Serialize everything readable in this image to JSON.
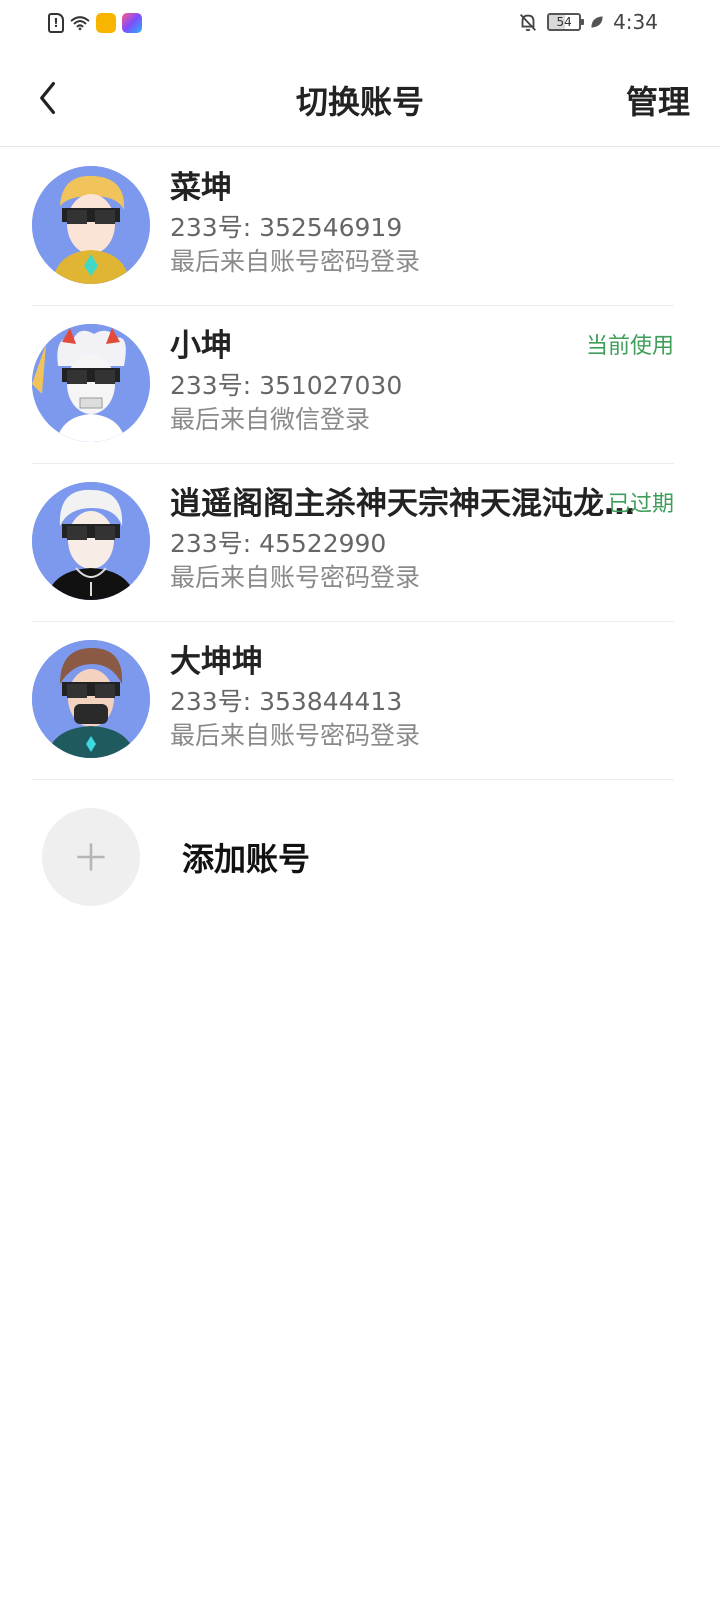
{
  "status_bar": {
    "battery": "54",
    "time": "4:34",
    "icons": [
      "sim-alert-icon",
      "wifi-icon",
      "app-notification-icon",
      "app-notification-icon",
      "bell-off-icon",
      "battery-icon",
      "leaf-icon"
    ]
  },
  "header": {
    "back_icon": "chevron-left-icon",
    "title": "切换账号",
    "manage_label": "管理"
  },
  "accounts": [
    {
      "name": "菜坤",
      "id_text": "233号: 352546919",
      "login_text": "最后来自账号密码登录",
      "tag": ""
    },
    {
      "name": "小坤",
      "id_text": "233号: 351027030",
      "login_text": "最后来自微信登录",
      "tag": "当前使用"
    },
    {
      "name": "逍遥阁阁主杀神天宗神天混沌龙…",
      "id_text": "233号: 45522990",
      "login_text": "最后来自账号密码登录",
      "tag": "已过期"
    },
    {
      "name": "大坤坤",
      "id_text": "233号: 353844413",
      "login_text": "最后来自账号密码登录",
      "tag": ""
    }
  ],
  "add_account": {
    "label": "添加账号",
    "icon": "plus-icon"
  },
  "colors": {
    "tag_green": "#3f9e5a",
    "avatar_bg": "#7c99ee",
    "divider": "#ececec"
  }
}
